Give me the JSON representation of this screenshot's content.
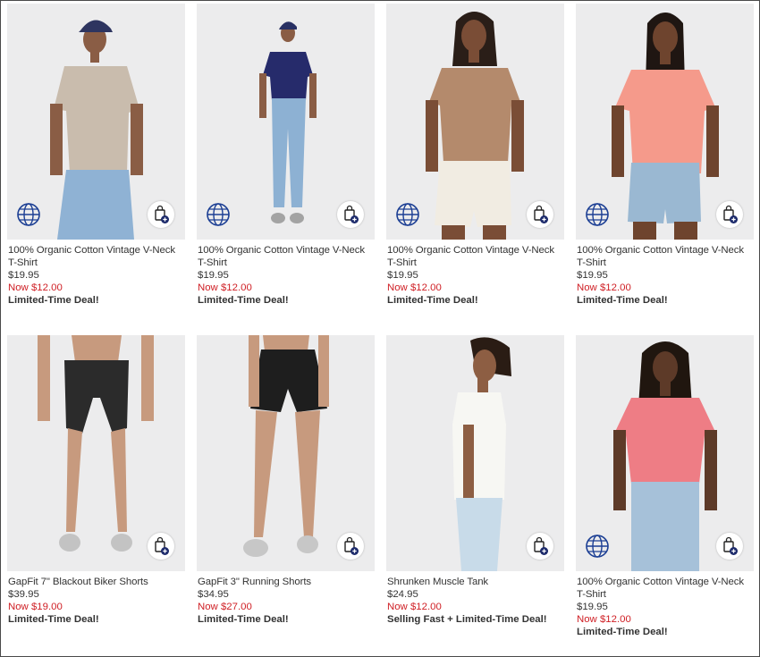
{
  "products": [
    {
      "name": "100% Organic Cotton Vintage V-Neck T-Shirt",
      "price": "$19.95",
      "sale": "Now $12.00",
      "deal": "Limited-Time Deal!",
      "globe": true,
      "shirt": "#c9bcad",
      "bottom": "#8fb2d4",
      "hat": "#2e3560",
      "skin": "#8a5d45"
    },
    {
      "name": "100% Organic Cotton Vintage V-Neck T-Shirt",
      "price": "$19.95",
      "sale": "Now $12.00",
      "deal": "Limited-Time Deal!",
      "globe": true,
      "shirt": "#262b6b",
      "bottom": "#8db1d3",
      "hat": "#283063",
      "skin": "#8a5d45"
    },
    {
      "name": "100% Organic Cotton Vintage V-Neck T-Shirt",
      "price": "$19.95",
      "sale": "Now $12.00",
      "deal": "Limited-Time Deal!",
      "globe": true,
      "shirt": "#b48a6c",
      "bottom": "#f1ece2",
      "hat": "",
      "skin": "#7a4d36"
    },
    {
      "name": "100% Organic Cotton Vintage V-Neck T-Shirt",
      "price": "$19.95",
      "sale": "Now $12.00",
      "deal": "Limited-Time Deal!",
      "globe": true,
      "shirt": "#f59a8b",
      "bottom": "#9ab8d2",
      "hat": "",
      "skin": "#6e442e"
    },
    {
      "name": "GapFit 7\" Blackout Biker Shorts",
      "price": "$39.95",
      "sale": "Now $19.00",
      "deal": "Limited-Time Deal!",
      "globe": false,
      "shirt": "",
      "bottom": "#2b2b2b",
      "hat": "",
      "skin": "#c79a7e"
    },
    {
      "name": "GapFit 3\" Running Shorts",
      "price": "$34.95",
      "sale": "Now $27.00",
      "deal": "Limited-Time Deal!",
      "globe": false,
      "shirt": "",
      "bottom": "#1e1e1e",
      "hat": "",
      "skin": "#c79a7e"
    },
    {
      "name": "Shrunken Muscle Tank",
      "price": "$24.95",
      "sale": "Now $12.00",
      "deal": "Selling Fast + Limited-Time Deal!",
      "globe": false,
      "shirt": "#f7f7f3",
      "bottom": "#c8dbe9",
      "hat": "",
      "skin": "#8d5e43"
    },
    {
      "name": "100% Organic Cotton Vintage V-Neck T-Shirt",
      "price": "$19.95",
      "sale": "Now $12.00",
      "deal": "Limited-Time Deal!",
      "globe": true,
      "shirt": "#ee7d85",
      "bottom": "#a6c1d9",
      "hat": "",
      "skin": "#5d3a28"
    }
  ]
}
